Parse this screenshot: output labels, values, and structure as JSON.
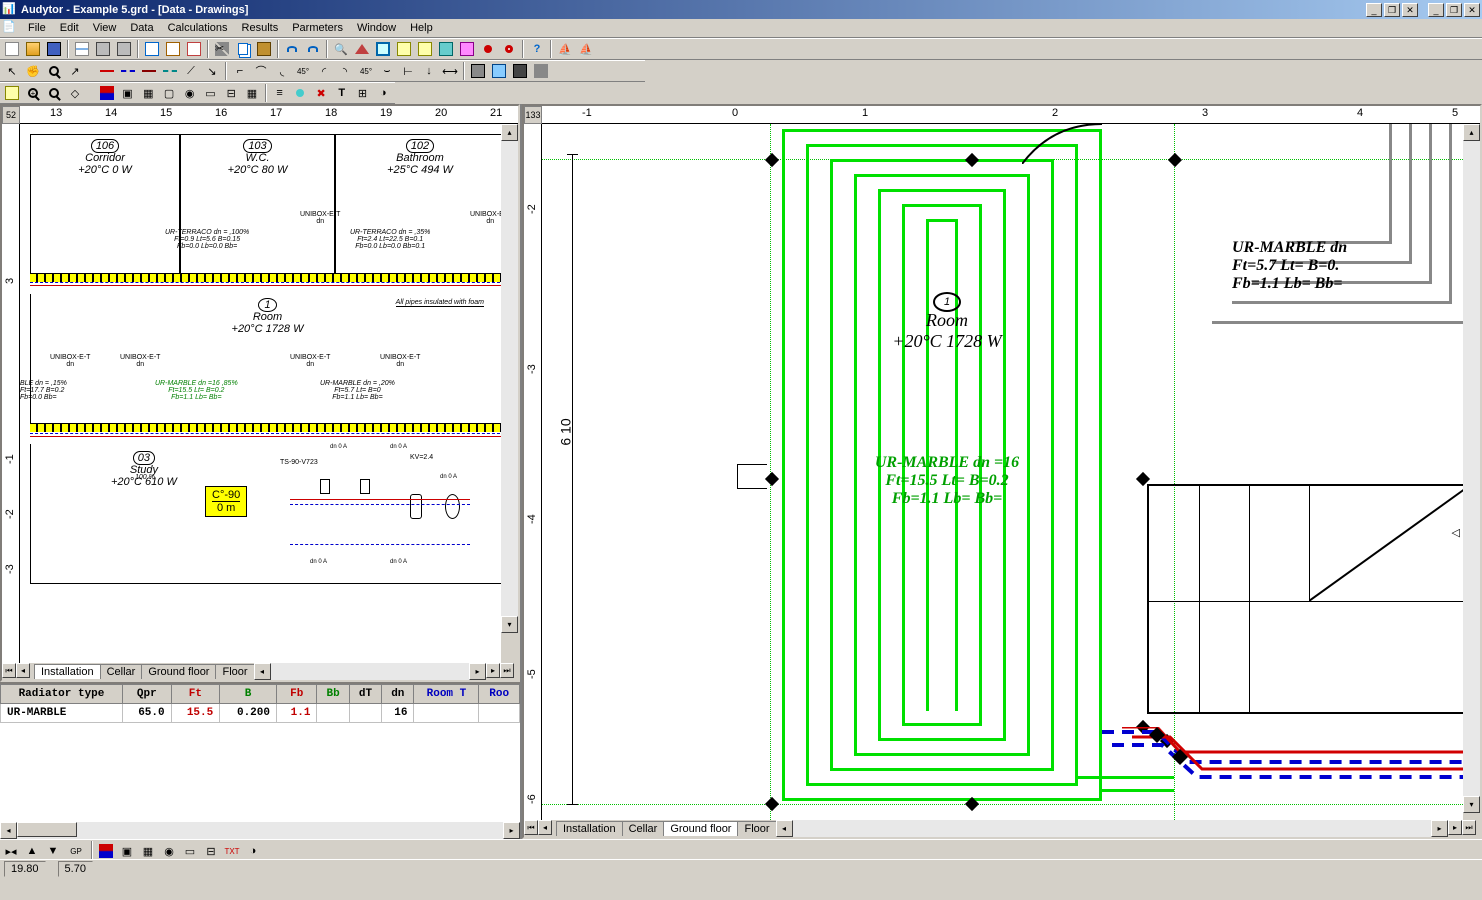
{
  "titlebar": {
    "app": "Audytor",
    "file": "Example 5.grd",
    "section": "[Data - Drawings]"
  },
  "menu": [
    "File",
    "Edit",
    "View",
    "Data",
    "Calculations",
    "Results",
    "Parmeters",
    "Window",
    "Help"
  ],
  "toolbar2_start": "52",
  "toolbar2r_start": "133",
  "left_ruler_ticks": [
    "13",
    "14",
    "15",
    "16",
    "17",
    "18",
    "19",
    "20",
    "21"
  ],
  "left_ruler_v": [
    "3",
    "-1",
    "-2",
    "-3"
  ],
  "right_ruler_ticks": [
    "-1",
    "0",
    "1",
    "2",
    "3",
    "4",
    "5"
  ],
  "right_ruler_v": [
    "-2",
    "-3",
    "-4",
    "-5",
    "-6"
  ],
  "left_drawing": {
    "rooms": [
      {
        "id": "106",
        "name": "Corridor",
        "temp": "+20°C 0 W"
      },
      {
        "id": "103",
        "name": "W.C.",
        "temp": "+20°C 80 W"
      },
      {
        "id": "102",
        "name": "Bathroom",
        "temp": "+25°C 494 W"
      },
      {
        "id": "1",
        "name": "Room",
        "temp": "+20°C 1728 W"
      },
      {
        "id": "03",
        "name": "Study",
        "temp": "+20°C 610 W"
      }
    ],
    "labels": {
      "terraco1": "UR-TERRACO dn = ,100%\nFt=0.9 Lt=5.6 B=0.15\nFb=0.0 Lb=0.0 Bb=",
      "terraco2": "UR-TERRACO dn = ,35%\nFt=2.4 Lt=22.5 B=0.1\nFb=0.0 Lb=0.0 Bb=0.1",
      "note1": "All pipes insulated with foam",
      "unibox": "UNIBOX-E-T\ndn",
      "marble1": "BLE dn = ,15%\nFt=17.7 B=0.2\nFb=0.0 Bb=",
      "marble2": "UR-MARBLE dn =16 ,85%\nFt=15.5 Lt= B=0.2\nFb=1.1 Lb= Bb=",
      "marble3": "UR-MARBLE dn = ,20%\nFt=5.7 Lt= B=0\nFb=1.1 Lb= Bb=",
      "c90": "C°-90",
      "c90m": "0 m",
      "pct100": "100 %",
      "ts": "TS-90-V723",
      "kv": "KV=2.4",
      "dnlab": "dn 0  A"
    }
  },
  "right_drawing": {
    "room": {
      "id": "1",
      "name": "Room",
      "temp": "+20°C 1728 W"
    },
    "marble": "UR-MARBLE dn =16\nFt=15.5 Lt= B=0.2\nFb=1.1 Lb= Bb=",
    "marble2": "UR-MARBLE dn\nFt=5.7 Lt= B=0.\nFb=1.1 Lb= Bb=",
    "dim": "6 10"
  },
  "tabs": [
    "Installation",
    "Cellar",
    "Ground floor",
    "Floor"
  ],
  "left_tab_active": 0,
  "right_tab_active": 2,
  "table": {
    "headers": [
      "Radiator type",
      "Qpr",
      "Ft",
      "B",
      "Fb",
      "Bb",
      "dT",
      "dn",
      "Room T",
      "Roo"
    ],
    "row": {
      "type": "UR-MARBLE",
      "qpr": "65.0",
      "ft": "15.5",
      "b": "0.200",
      "fb": "1.1",
      "bb": "",
      "dt": "",
      "dn": "16",
      "roomt": "",
      "roo": ""
    }
  },
  "status": {
    "x": "19.80",
    "y": "5.70"
  }
}
